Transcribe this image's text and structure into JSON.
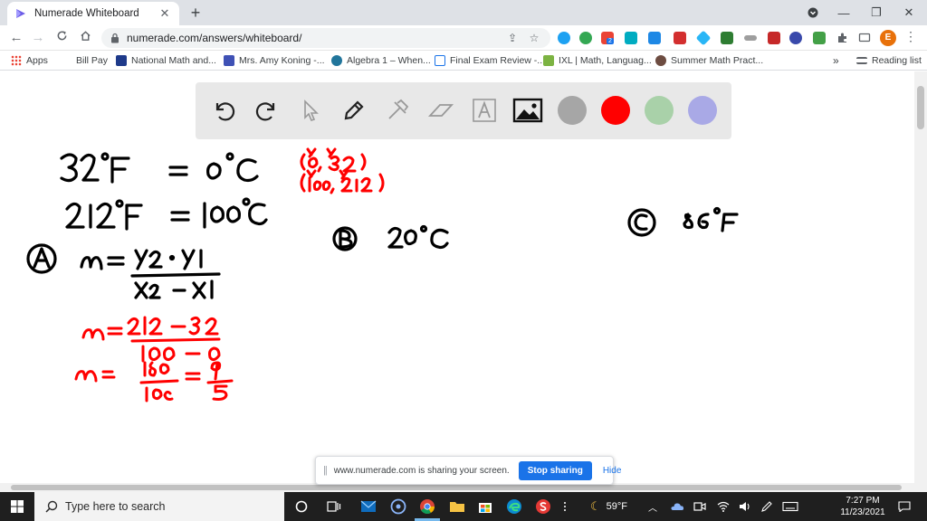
{
  "browser": {
    "tab_title": "Numerade Whiteboard",
    "tab_close": "✕",
    "new_tab": "+",
    "url": "numerade.com/answers/whiteboard/",
    "profile_initial": "E",
    "window_minimize": "—",
    "window_restore": "❐",
    "window_close": "✕",
    "extension_badge": "2"
  },
  "bookmarks": {
    "items": [
      {
        "label": "Apps"
      },
      {
        "label": "Bill Pay"
      },
      {
        "label": "National Math and..."
      },
      {
        "label": "Mrs. Amy Koning -..."
      },
      {
        "label": "Algebra 1 – When..."
      },
      {
        "label": "Final Exam Review -..."
      },
      {
        "label": "IXL | Math, Languag..."
      },
      {
        "label": "Summer Math Pract..."
      }
    ],
    "overflow": "»",
    "reading_list": "Reading list"
  },
  "whiteboard": {
    "colors": {
      "gray": "#a6a6a6",
      "red": "#ff0000",
      "green": "#a9d1a9",
      "purple": "#a9a9e6",
      "ink_black": "#000000",
      "ink_red": "#ff0000"
    }
  },
  "share_banner": {
    "grip": "||",
    "message": "www.numerade.com is sharing your screen.",
    "stop_label": "Stop sharing",
    "hide_label": "Hide"
  },
  "taskbar": {
    "search_placeholder": "Type here to search",
    "weather": "59°F",
    "time": "7:27 PM",
    "date": "11/23/2021"
  }
}
